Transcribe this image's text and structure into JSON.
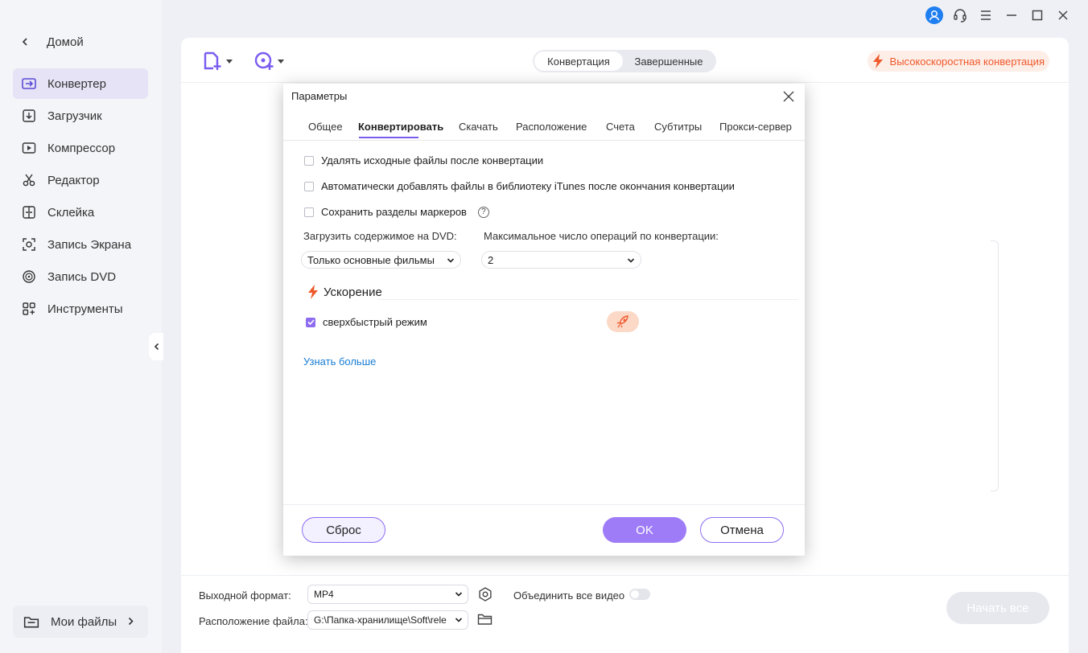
{
  "sidebar": {
    "home": "Домой",
    "items": [
      {
        "label": "Конвертер",
        "icon": "converter-icon",
        "active": true
      },
      {
        "label": "Загрузчик",
        "icon": "downloader-icon"
      },
      {
        "label": "Компрессор",
        "icon": "compressor-icon"
      },
      {
        "label": "Редактор",
        "icon": "scissors-icon"
      },
      {
        "label": "Склейка",
        "icon": "merge-icon"
      },
      {
        "label": "Запись Экрана",
        "icon": "screen-record-icon"
      },
      {
        "label": "Запись DVD",
        "icon": "dvd-icon"
      },
      {
        "label": "Инструменты",
        "icon": "tools-grid-icon"
      }
    ],
    "my_files": "Мои файлы"
  },
  "header": {
    "segments": [
      "Конвертация",
      "Завершенные"
    ],
    "active_segment": "Конвертация",
    "turbo_label": "Высокоскоростная конвертация"
  },
  "bottom": {
    "output_format_label": "Выходной формат:",
    "output_format_value": "MP4",
    "merge_label": "Объединить все видео",
    "merge_enabled": false,
    "location_label": "Расположение файла:",
    "location_value": "G:\\Папка-хранилище\\Soft\\rele",
    "start_all": "Начать все"
  },
  "dialog": {
    "title": "Параметры",
    "tabs": [
      "Общее",
      "Конвертировать",
      "Скачать",
      "Расположение",
      "Счета",
      "Субтитры",
      "Прокси-сервер"
    ],
    "active_tab": "Конвертировать",
    "options": [
      {
        "label": "Удалять исходные файлы после конвертации",
        "checked": false
      },
      {
        "label": "Автоматически добавлять файлы в библиотеку iTunes после окончания конвертации",
        "checked": false
      },
      {
        "label": "Сохранить разделы маркеров",
        "checked": false,
        "help": "?"
      }
    ],
    "dvd_label": "Загрузить содержимое на DVD:",
    "dvd_value": "Только основные фильмы",
    "max_ops_label": "Максимальное число операций по конвертации:",
    "max_ops_value": "2",
    "accel_title": "Ускорение",
    "turbo_mode_label": "сверхбыстрый режим",
    "turbo_mode_checked": true,
    "learn_more": "Узнать больше",
    "reset_button": "Сброс",
    "ok_button": "OK",
    "cancel_button": "Отмена"
  },
  "colors": {
    "accent": "#8e6cf2",
    "turbo": "#ef5a2c",
    "link": "#1a7ed4",
    "avatar": "#1f7ff0"
  }
}
